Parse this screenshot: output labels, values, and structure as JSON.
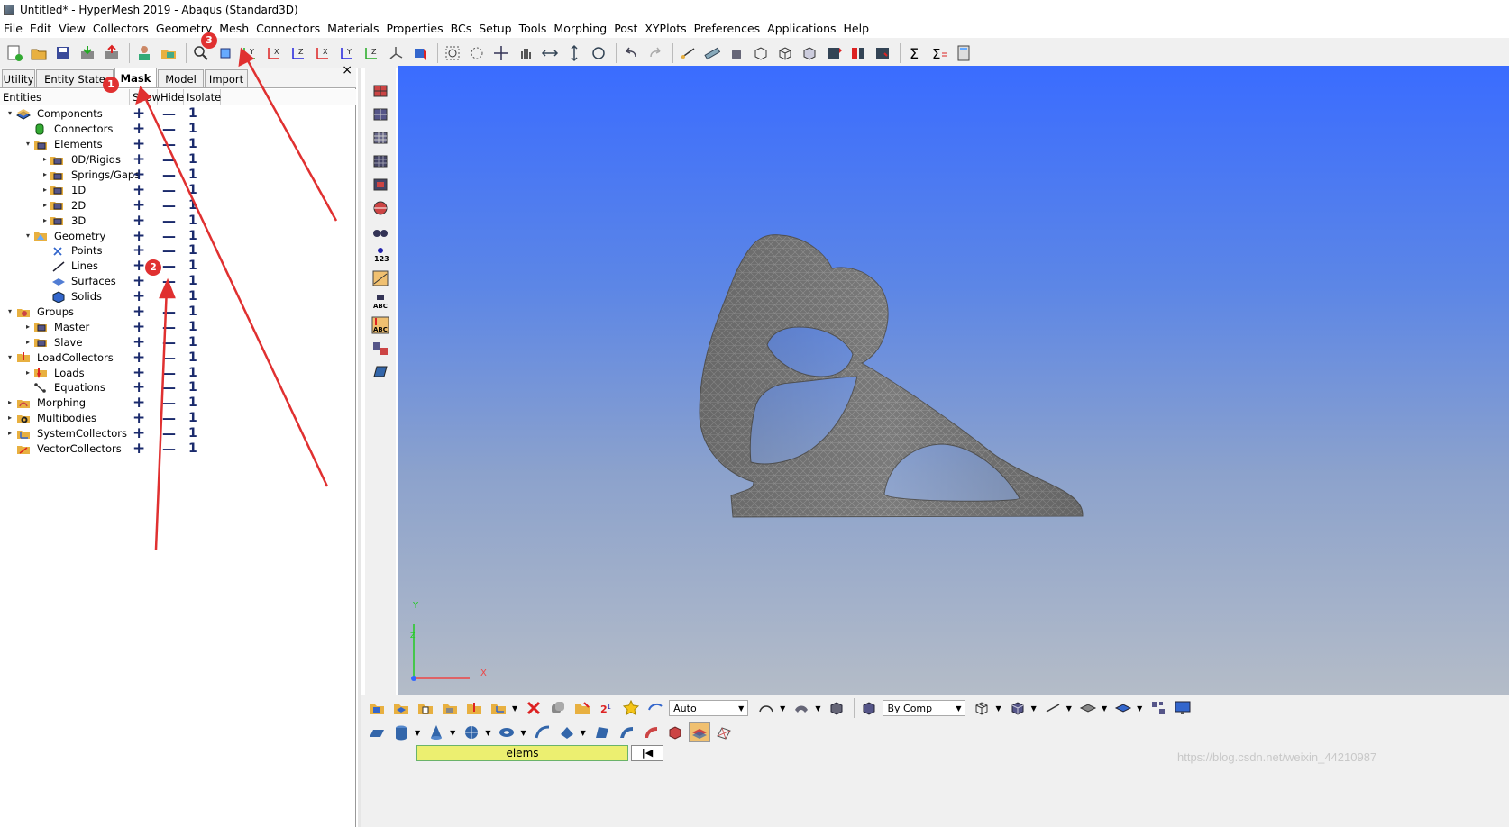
{
  "window": {
    "title": "Untitled* - HyperMesh 2019 - Abaqus (Standard3D)"
  },
  "menubar": {
    "items": [
      "File",
      "Edit",
      "View",
      "Collectors",
      "Geometry",
      "Mesh",
      "Connectors",
      "Materials",
      "Properties",
      "BCs",
      "Setup",
      "Tools",
      "Morphing",
      "Post",
      "XYPlots",
      "Preferences",
      "Applications",
      "Help"
    ]
  },
  "left_panel": {
    "tabs": [
      "Utility",
      "Entity State",
      "Mask",
      "Model",
      "Import"
    ],
    "active_tab": "Mask",
    "close_glyph": "×",
    "columns": {
      "entities": "Entities",
      "show": "Show",
      "hide": "Hide",
      "isolate": "Isolate"
    },
    "show_glyph": "+",
    "hide_glyph": "—",
    "isolate_glyph": "1",
    "tree": [
      {
        "label": "Components",
        "icon": "components-icon"
      },
      {
        "label": "Connectors",
        "icon": "connector-icon"
      },
      {
        "label": "Elements",
        "icon": "elements-icon"
      },
      {
        "label": "0D/Rigids",
        "icon": "elements-icon"
      },
      {
        "label": "Springs/Gaps",
        "icon": "elements-icon"
      },
      {
        "label": "1D",
        "icon": "elements-icon"
      },
      {
        "label": "2D",
        "icon": "elements-icon"
      },
      {
        "label": "3D",
        "icon": "elements-icon"
      },
      {
        "label": "Geometry",
        "icon": "geometry-icon"
      },
      {
        "label": "Points",
        "icon": "point-icon"
      },
      {
        "label": "Lines",
        "icon": "line-icon"
      },
      {
        "label": "Surfaces",
        "icon": "surface-icon"
      },
      {
        "label": "Solids",
        "icon": "solid-icon"
      },
      {
        "label": "Groups",
        "icon": "groups-icon"
      },
      {
        "label": "Master",
        "icon": "elements-icon"
      },
      {
        "label": "Slave",
        "icon": "elements-icon"
      },
      {
        "label": "LoadCollectors",
        "icon": "loadcollector-icon"
      },
      {
        "label": "Loads",
        "icon": "load-icon"
      },
      {
        "label": "Equations",
        "icon": "equation-icon"
      },
      {
        "label": "Morphing",
        "icon": "morphing-icon"
      },
      {
        "label": "Multibodies",
        "icon": "multibody-icon"
      },
      {
        "label": "SystemCollectors",
        "icon": "system-icon"
      },
      {
        "label": "VectorCollectors",
        "icon": "vector-icon"
      }
    ]
  },
  "annotations": [
    "1",
    "2",
    "3"
  ],
  "viewport": {
    "axis_y": "Y",
    "axis_x": "X",
    "axis_z": "Z"
  },
  "bottom_bar": {
    "auto_select": "Auto",
    "color_mode": "By Comp",
    "entity_field": "elems",
    "nav_button": "|◀"
  },
  "watermark": "https://blog.csdn.net/weixin_44210987",
  "colors": {
    "viewport_top": "#3a6cff",
    "viewport_bottom": "#b4bcc8",
    "annotation_red": "#e03030",
    "entity_field_bg": "#ecef70"
  }
}
